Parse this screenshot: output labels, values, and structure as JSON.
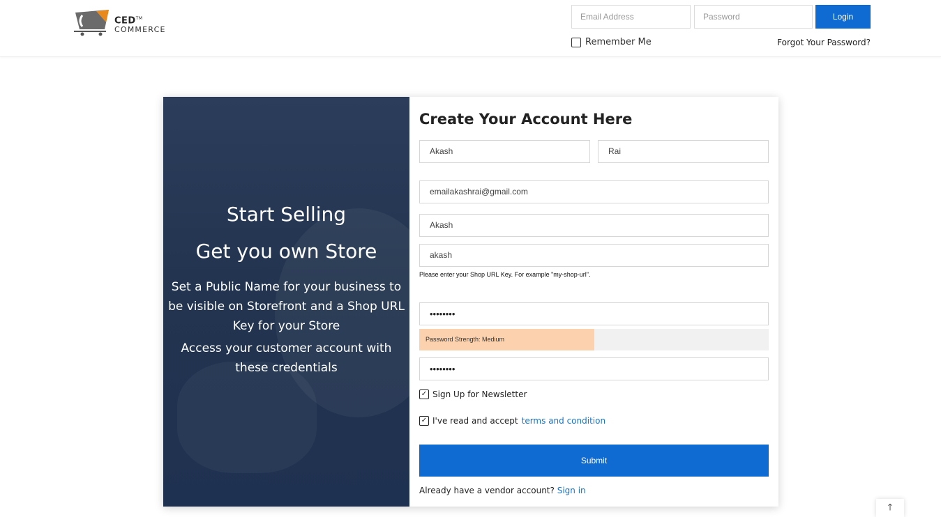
{
  "brand": {
    "name_top": "CED",
    "trademark": "TM",
    "name_bottom": "COMMERCE"
  },
  "header": {
    "email_placeholder": "Email Address",
    "password_placeholder": "Password",
    "login_label": "Login",
    "remember_label": "Remember Me",
    "forgot_label": "Forgot Your Password?"
  },
  "promo": {
    "line1": "Start Selling",
    "line2": "Get you own Store",
    "line3": "Set a Public Name for your business to be visible on Storefront and a Shop URL Key for your Store",
    "line4": "Access your customer account with these credentials"
  },
  "form": {
    "title": "Create Your Account Here",
    "first_name": "Akash",
    "last_name": "Rai",
    "email": "emailakashrai@gmail.com",
    "public_name": "Akash",
    "shop_url": "akash",
    "shop_url_hint": "Please enter your Shop URL Key. For example \"my-shop-url\".",
    "password": "••••••••",
    "strength_label": "Password Strength: Medium",
    "strength_fraction": 0.5,
    "confirm_password": "••••••••",
    "newsletter_label": "Sign Up for Newsletter",
    "newsletter_checked": true,
    "terms_prefix": "I've read and accept",
    "terms_link": "terms and condition",
    "terms_checked": true,
    "submit_label": "Submit",
    "signin_prefix": "Already have a vendor account?",
    "signin_link": "Sign in"
  },
  "colors": {
    "primary": "#0f6bd1",
    "link": "#1a73c9",
    "strength_medium": "#fcd2ae",
    "panel": "#22344f"
  },
  "icons": {
    "back_to_top": "arrow-up-icon",
    "check": "checkmark-icon",
    "cart": "cart-logo-icon"
  }
}
